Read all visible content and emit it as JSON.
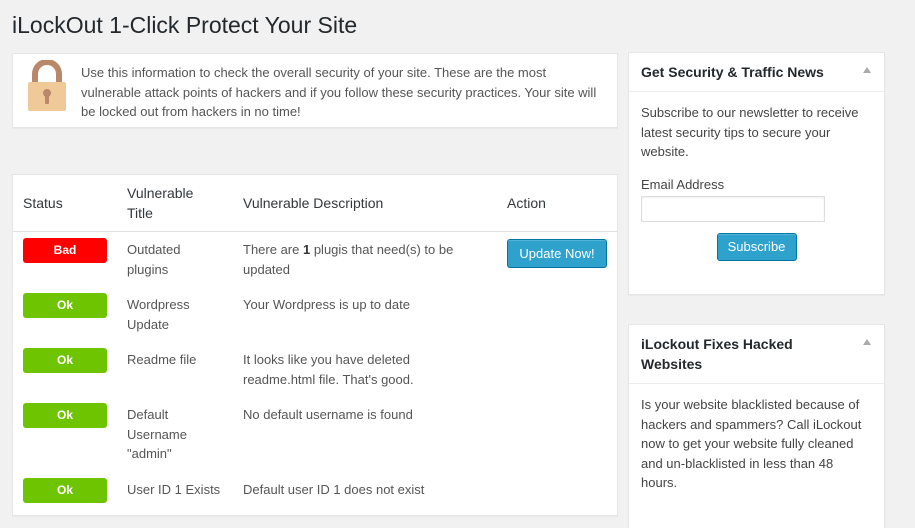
{
  "page": {
    "title": "iLockOut 1-Click Protect Your Site"
  },
  "notice": {
    "icon": "padlock-icon",
    "text": "Use this information to check the overall security of your site. These are the most vulnerable attack points of hackers and if you follow these security practices. Your site will be locked out from hackers in no time!"
  },
  "table": {
    "headers": {
      "status": "Status",
      "title": "Vulnerable Title",
      "description": "Vulnerable Description",
      "action": "Action"
    },
    "rows": [
      {
        "status": "Bad",
        "title": "Outdated plugins",
        "desc_pre": "There are ",
        "desc_bold": "1",
        "desc_post": " plugis that need(s) to be updated",
        "action": "Update Now!"
      },
      {
        "status": "Ok",
        "title": "Wordpress Update",
        "description": "Your Wordpress is up to date"
      },
      {
        "status": "Ok",
        "title": "Readme file",
        "description": "It looks like you have deleted readme.html file. That's good."
      },
      {
        "status": "Ok",
        "title": "Default Username \"admin\"",
        "description": "No default username is found"
      },
      {
        "status": "Ok",
        "title": "User ID 1 Exists",
        "description": "Default user ID 1 does not exist"
      }
    ]
  },
  "news": {
    "title": "Get Security & Traffic News",
    "text": "Subscribe to our newsletter to receive latest security tips to secure your website.",
    "email_label": "Email Address",
    "email_value": "",
    "button": "Subscribe"
  },
  "fixes": {
    "title": "iLockout Fixes Hacked Websites",
    "text": "Is your website blacklisted because of hackers and spammers? Call iLockout now to get your website fully cleaned and un-blacklisted in less than 48 hours."
  },
  "colors": {
    "bad": "#ff0000",
    "ok": "#6fc400",
    "button": "#2ea2cc",
    "lock_body": "#f0c998",
    "lock_shackle": "#b9886a"
  }
}
